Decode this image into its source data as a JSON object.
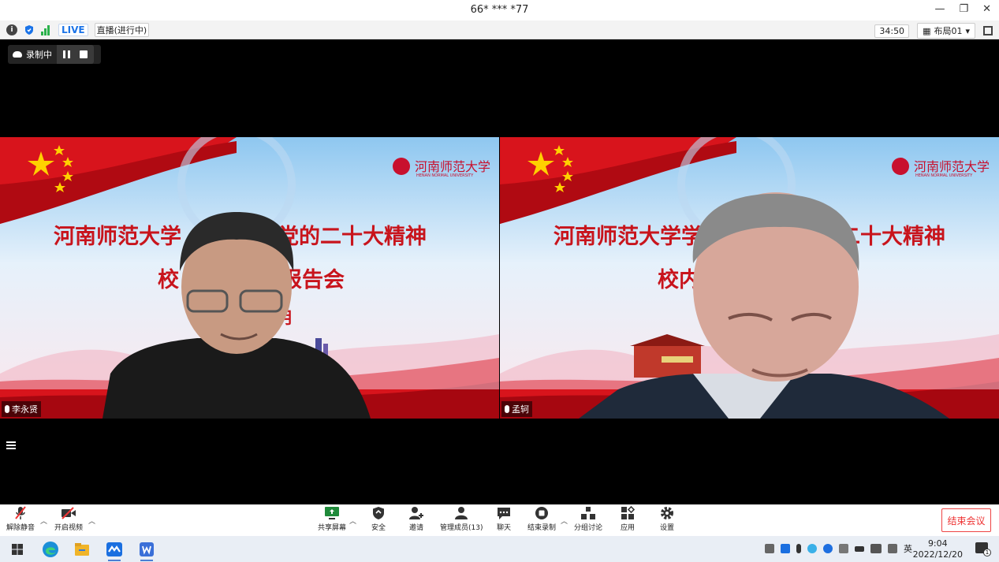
{
  "window": {
    "title": "66* *** *77"
  },
  "status": {
    "live_label": "LIVE",
    "live_status": "直播(进行中)",
    "timer": "34:50",
    "layout_label": "布局01"
  },
  "recording": {
    "label": "录制中"
  },
  "tiles": [
    {
      "name": "李永贤",
      "banner_line1_left": "河南师范大学",
      "banner_line1_right": "党的二十大精神",
      "banner_line2_left": "校",
      "banner_line2_right": "报告会",
      "banner_line3": "月",
      "logo_text": "河南师范大学",
      "logo_sub": "HENAN NORMAL UNIVERSITY"
    },
    {
      "name": "孟轲",
      "banner_line1_left": "河南师范大学学",
      "banner_line1_right": "二十大精神",
      "banner_line2_left": "校内",
      "banner_line2_right": "",
      "banner_line3": "",
      "logo_text": "河南师范大学",
      "logo_sub": "HENAN NORMAL UNIVERSITY"
    }
  ],
  "toolbar": {
    "unmute": "解除静音",
    "start_video": "开启视频",
    "share_screen": "共享屏幕",
    "security": "安全",
    "invite": "邀请",
    "participants": "管理成员(13)",
    "chat": "聊天",
    "end_record": "结束录制",
    "breakout": "分组讨论",
    "apps": "应用",
    "settings": "设置",
    "end_meeting": "结束会议"
  },
  "taskbar": {
    "ime": "英",
    "time": "9:04",
    "date": "2022/12/20",
    "notif_count": "1"
  },
  "colors": {
    "accent_red": "#e33333",
    "accent_blue": "#1a73e8",
    "banner_red": "#d8141c"
  }
}
